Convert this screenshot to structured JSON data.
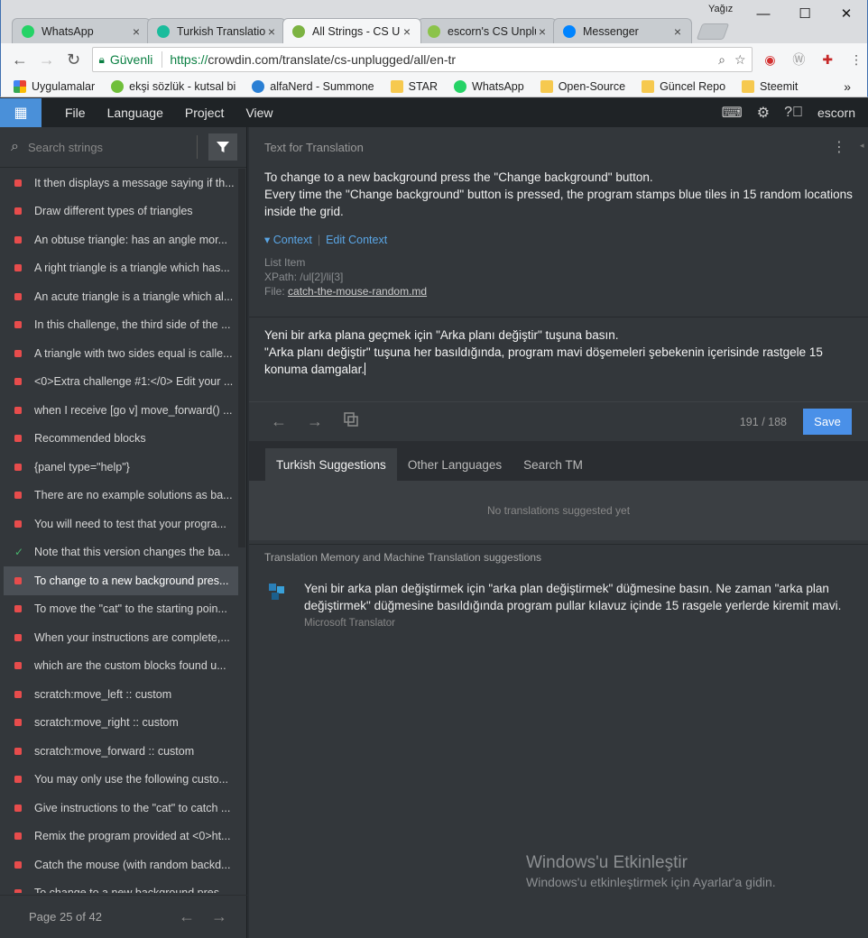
{
  "browser": {
    "profile": "Yağız",
    "tabs": [
      {
        "title": "WhatsApp",
        "color": "#25d366"
      },
      {
        "title": "Turkish Translatio",
        "color": "#1abc9c"
      },
      {
        "title": "All Strings - CS Un",
        "color": "#7cb342"
      },
      {
        "title": "escorn's CS Unplu",
        "color": "#8bc34a"
      },
      {
        "title": "Messenger",
        "color": "#0084ff"
      }
    ],
    "secure_label": "Güvenli",
    "url_scheme": "https://",
    "url_rest": "crowdin.com/translate/cs-unplugged/all/en-tr",
    "bookmarks": [
      "Uygulamalar",
      "ekşi sözlük - kutsal bi",
      "alfaNerd - Summone",
      "STAR",
      "WhatsApp",
      "Open-Source",
      "Güncel Repo",
      "Steemit"
    ],
    "bookmarks_more": "»"
  },
  "app": {
    "menu": [
      "File",
      "Language",
      "Project",
      "View"
    ],
    "user": "escorn",
    "search_placeholder": "Search strings",
    "strings": [
      {
        "text": "It then displays a message saying if th...",
        "status": "untranslated"
      },
      {
        "text": "Draw different types of triangles",
        "status": "untranslated"
      },
      {
        "text": "An obtuse triangle: has an angle mor...",
        "status": "untranslated"
      },
      {
        "text": "A right triangle is a triangle which has...",
        "status": "untranslated"
      },
      {
        "text": "An acute triangle is a triangle which al...",
        "status": "untranslated"
      },
      {
        "text": "In this challenge, the third side of the ...",
        "status": "untranslated"
      },
      {
        "text": "A triangle with two sides equal is calle...",
        "status": "untranslated"
      },
      {
        "text": "<0>Extra challenge #1:</0> Edit your ...",
        "status": "untranslated"
      },
      {
        "text": "when I receive [go v] move_forward() ...",
        "status": "untranslated"
      },
      {
        "text": "Recommended blocks",
        "status": "untranslated"
      },
      {
        "text": "{panel type=\"help\"}",
        "status": "untranslated"
      },
      {
        "text": "There are no example solutions as ba...",
        "status": "untranslated"
      },
      {
        "text": "You will need to test that your progra...",
        "status": "untranslated"
      },
      {
        "text": "Note that this version changes the ba...",
        "status": "translated"
      },
      {
        "text": "To change to a new background pres...",
        "status": "untranslated",
        "selected": true
      },
      {
        "text": "To move the \"cat\" to the starting poin...",
        "status": "untranslated"
      },
      {
        "text": "When your instructions are complete,...",
        "status": "untranslated"
      },
      {
        "text": "which are the custom blocks found u...",
        "status": "untranslated"
      },
      {
        "text": "scratch:move_left :: custom",
        "status": "untranslated"
      },
      {
        "text": "scratch:move_right :: custom",
        "status": "untranslated"
      },
      {
        "text": "scratch:move_forward :: custom",
        "status": "untranslated"
      },
      {
        "text": "You may only use the following custo...",
        "status": "untranslated"
      },
      {
        "text": "Give instructions to the \"cat\" to catch ...",
        "status": "untranslated"
      },
      {
        "text": "Remix the program provided at <0>ht...",
        "status": "untranslated"
      },
      {
        "text": "Catch the mouse (with random backd...",
        "status": "untranslated"
      },
      {
        "text": "To change to a new background pres...",
        "status": "untranslated"
      }
    ],
    "pager": "Page 25 of 42",
    "source_header": "Text for Translation",
    "source_text_1": "To change to a new background press the \"Change background\" button.",
    "source_text_2": "Every time the \"Change background\" button is pressed, the program stamps blue tiles in 15 random locations inside the grid.",
    "context_label": "Context",
    "edit_context_label": "Edit Context",
    "meta_type": "List Item",
    "meta_xpath": "XPath: /ul[2]/li[3]",
    "meta_file_label": "File:",
    "meta_file": "catch-the-mouse-random.md",
    "translation_1": "Yeni bir arka plana geçmek için \"Arka planı değiştir\" tuşuna basın.",
    "translation_2": "\"Arka planı değiştir\" tuşuna her basıldığında, program mavi döşemeleri şebekenin içerisinde rastgele 15 konuma damgalar.",
    "counter": "191 / 188",
    "save_label": "Save",
    "suggestion_tabs": [
      "Turkish Suggestions",
      "Other Languages",
      "Search TM"
    ],
    "no_suggestions": "No translations suggested yet",
    "tm_header": "Translation Memory and Machine Translation suggestions",
    "tm_text": "Yeni bir arka plan değiştirmek için \"arka plan değiştirmek\" düğmesine basın. Ne zaman \"arka plan değiştirmek\" düğmesine basıldığında program pullar kılavuz içinde 15 rasgele yerlerde kiremit mavi.",
    "tm_source": "Microsoft Translator"
  },
  "watermark": {
    "line1": "Windows'u Etkinleştir",
    "line2": "Windows'u etkinleştirmek için Ayarlar'a gidin."
  },
  "colors": {
    "accent": "#4a90e8",
    "untranslated": "#e74c4c",
    "translated": "#46b26b"
  }
}
